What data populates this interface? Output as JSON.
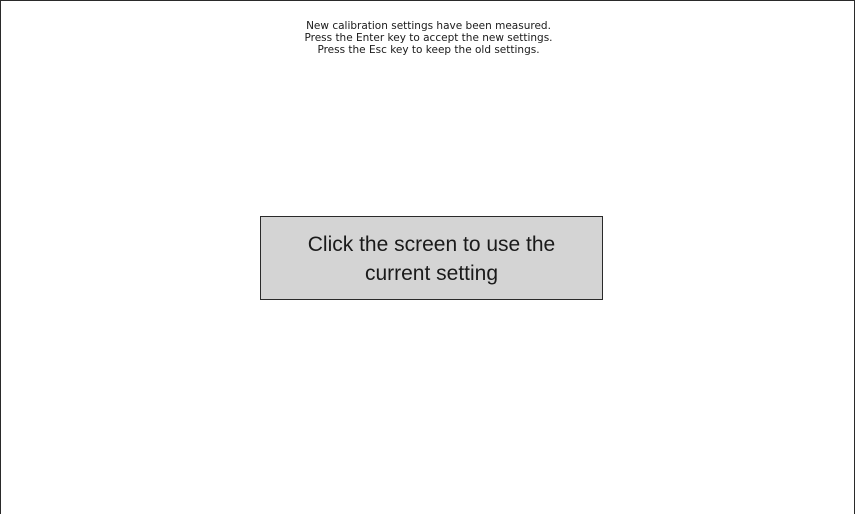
{
  "instructions": {
    "line1": "New calibration settings have been measured.",
    "line2": "Press the Enter key to accept the new settings.",
    "line3": "Press the Esc key to keep the old settings."
  },
  "confirm": {
    "line1": "Click the screen to use the",
    "line2": "current setting"
  },
  "colors": {
    "background": "#ffffff",
    "box_fill": "#d4d4d4",
    "border": "#2a2a2a",
    "text": "#1a1a1a"
  }
}
